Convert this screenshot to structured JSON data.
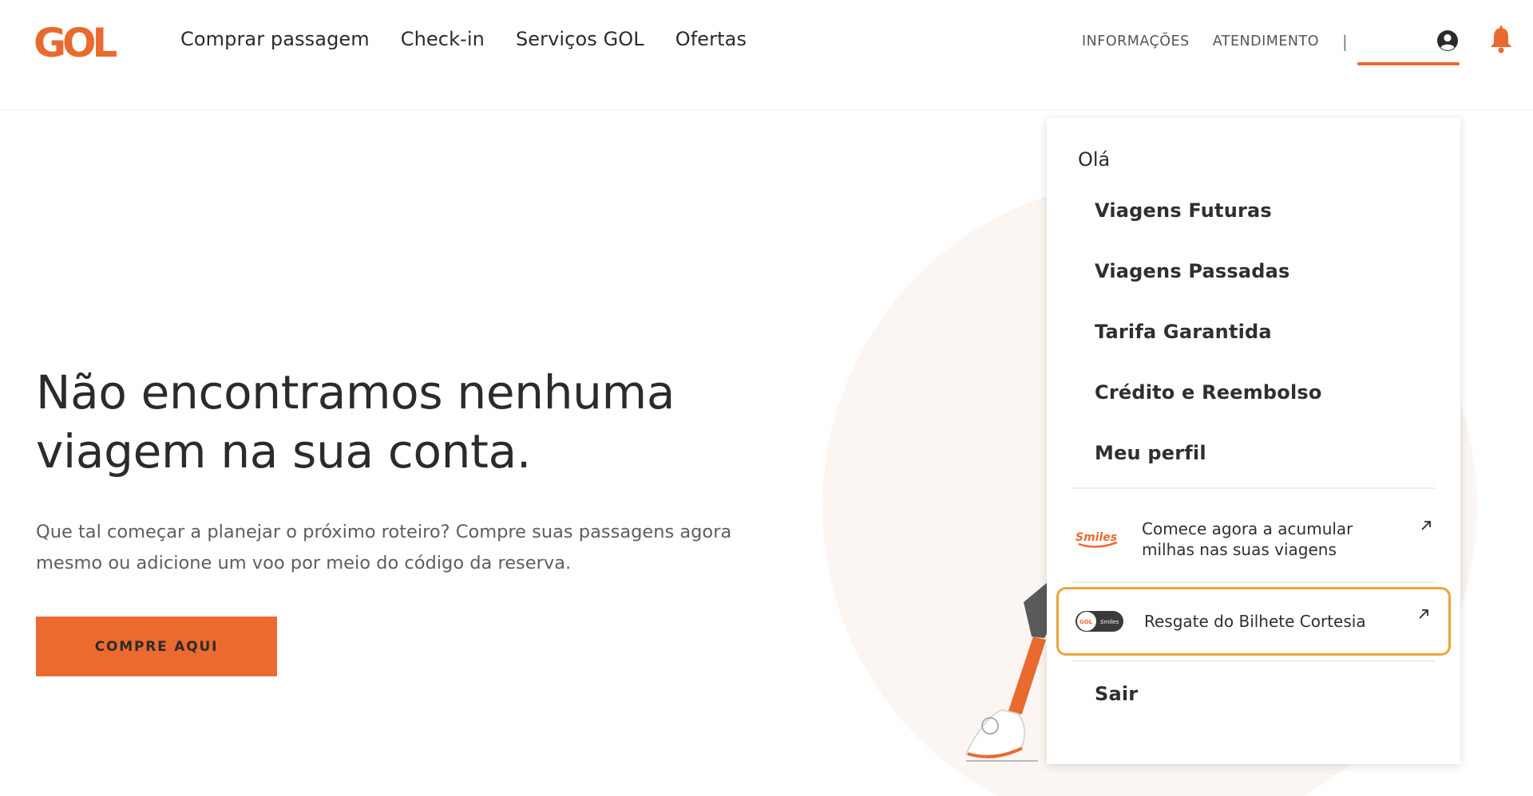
{
  "header": {
    "logo_text": "GOL",
    "nav": [
      "Comprar passagem",
      "Check-in",
      "Serviços GOL",
      "Ofertas"
    ],
    "util_nav": [
      "INFORMAÇÕES",
      "ATENDIMENTO"
    ],
    "separator": "|",
    "icons": [
      "user-circle-icon",
      "bell-icon"
    ]
  },
  "hero": {
    "title": "Não encontramos nenhuma viagem na sua conta.",
    "text": "Que tal começar a planejar o próximo roteiro? Compre suas passagens agora mesmo ou adicione um voo por meio do código da reserva.",
    "cta": "COMPRE AQUI"
  },
  "dropdown": {
    "greeting": "Olá",
    "items": [
      "Viagens Futuras",
      "Viagens Passadas",
      "Tarifa Garantida",
      "Crédito e Reembolso",
      "Meu perfil"
    ],
    "promo_smiles": {
      "logo_text": "Smiles",
      "text": "Comece agora a acumular milhas nas suas viagens"
    },
    "promo_cortesia": {
      "logo_text": "GOL Smiles",
      "text": "Resgate do Bilhete Cortesia"
    },
    "logout": "Sair"
  },
  "colors": {
    "brand_orange": "#ec6a2f",
    "highlight_border": "#f0a23a",
    "text_dark": "#2b2b2b"
  }
}
